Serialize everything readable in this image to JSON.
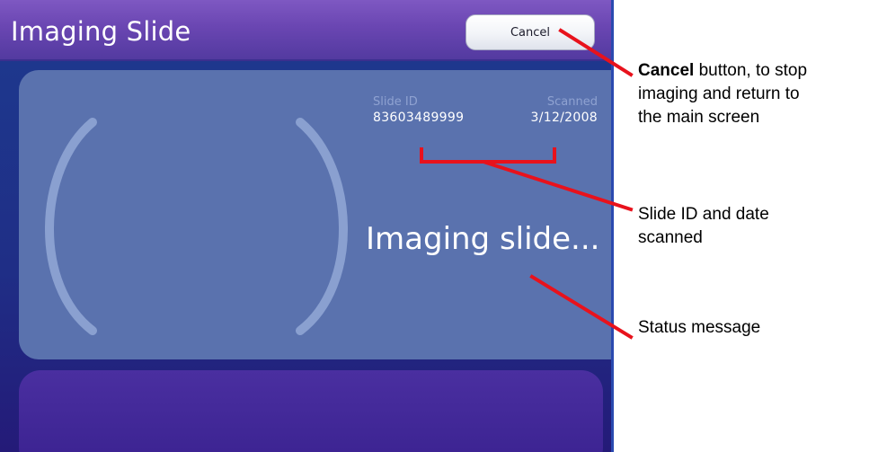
{
  "window": {
    "title": "Imaging Slide"
  },
  "toolbar": {
    "cancel_label": "Cancel"
  },
  "slide_info": {
    "slide_id_label": "Slide ID",
    "slide_id_value": "83603489999",
    "scanned_label": "Scanned",
    "scanned_value": "3/12/2008"
  },
  "status": {
    "message": "Imaging slide..."
  },
  "annotations": {
    "cancel": {
      "bold": "Cancel",
      "rest_line1": " button, to stop",
      "line2": "imaging and return to",
      "line3": "the main screen"
    },
    "slide_id": {
      "line1": "Slide ID and date",
      "line2": "scanned"
    },
    "status": {
      "line1": "Status message"
    }
  },
  "colors": {
    "callout_line": "#e8121c",
    "title_bar": "#6a46b2",
    "panel": "#5a72ae"
  }
}
